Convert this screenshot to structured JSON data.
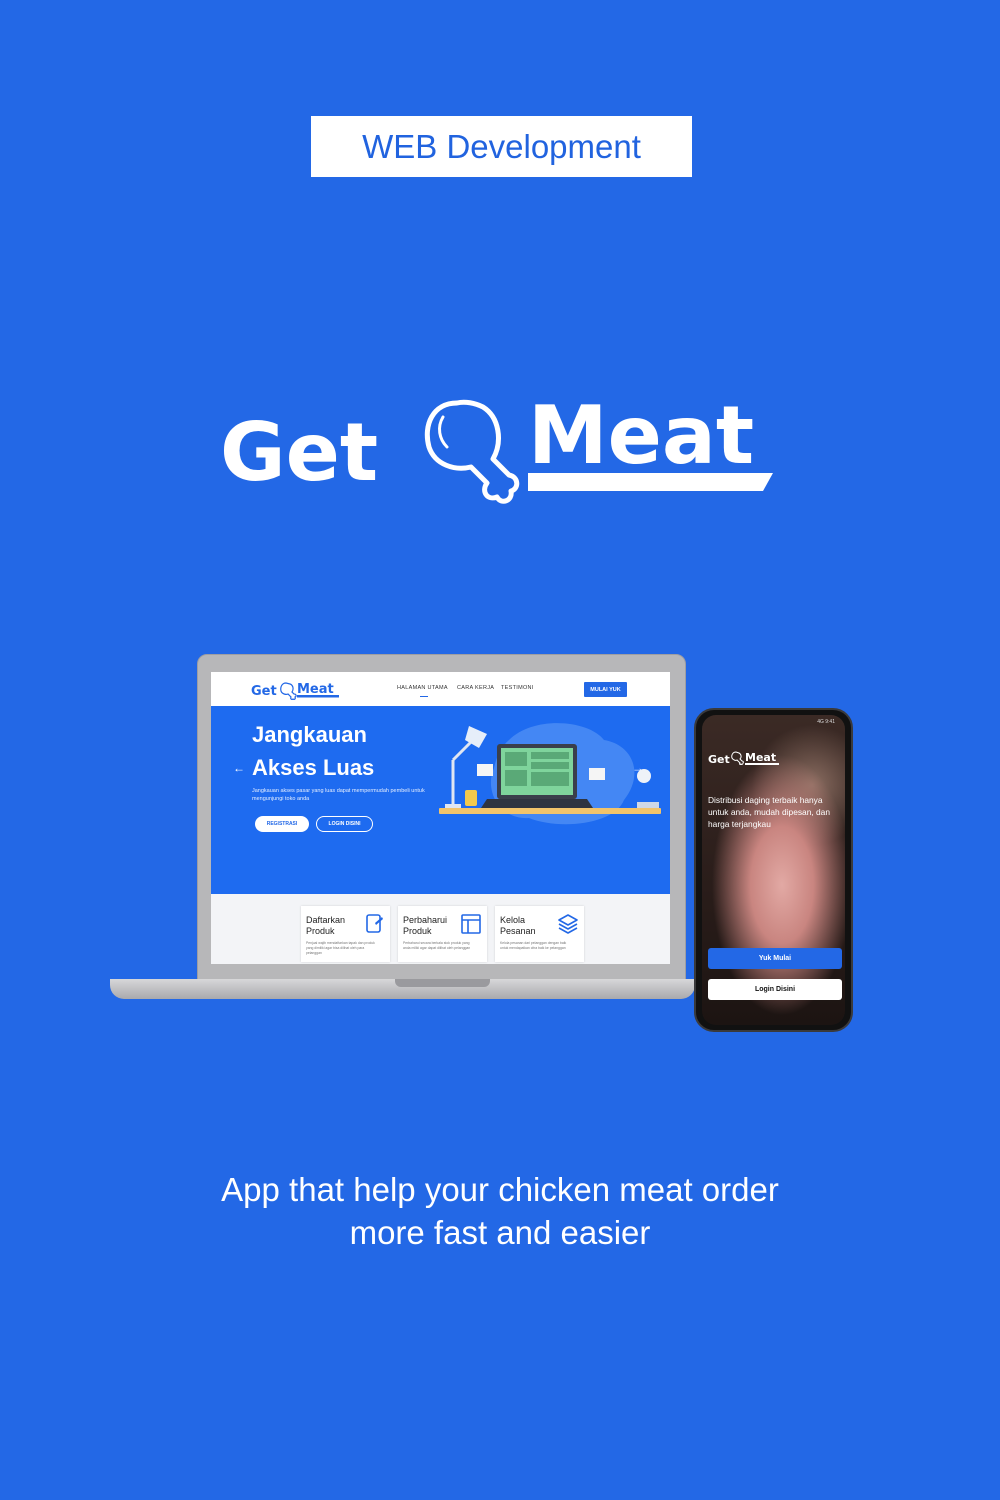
{
  "tag_label": "WEB Development",
  "brand": {
    "name_left": "Get",
    "name_right": "Meat",
    "logo_icon": "drumstick-icon"
  },
  "tagline": {
    "line1": "App that help your chicken meat order",
    "line2": "more fast and easier"
  },
  "colors": {
    "background": "#2368e6",
    "accent": "#1e6bf0",
    "white": "#ffffff"
  },
  "laptop": {
    "nav": {
      "logo_left": "Get",
      "logo_right": "Meat",
      "items": [
        "HALAMAN UTAMA",
        "CARA KERJA",
        "TESTIMONI"
      ],
      "cta": "MULAI YUK"
    },
    "hero": {
      "title_line1": "Jangkauan",
      "title_line2": "Akses Luas",
      "description": "Jangkauan akses pasar yang luas dapat mempermudah pembeli untuk mengunjungi toko anda",
      "btn_register": "REGISTRASI",
      "btn_login": "LOGIN DISINI",
      "arrow_left": "←",
      "arrow_right": "→"
    },
    "features": [
      {
        "title_line1": "Daftarkan",
        "title_line2": "Produk",
        "text": "Penjual wajib mendaftarkan tapak dan produk yang dimiliki agar bisa dilihat oleh para pelanggan",
        "icon": "document-icon"
      },
      {
        "title_line1": "Perbaharui",
        "title_line2": "Produk",
        "text": "Perbaharui secara berkala stok produk yang anda miliki agar dapat dilihat oleh pelanggan",
        "icon": "layout-icon"
      },
      {
        "title_line1": "Kelola",
        "title_line2": "Pesanan",
        "text": "Kelola pesanan dari pelanggan dengan baik untuk mendapatkan citra baik ke pelanggan",
        "icon": "layers-icon"
      }
    ]
  },
  "phone": {
    "status": "4G 9:41",
    "logo_left": "Get",
    "logo_right": "Meat",
    "text": "Distribusi daging terbaik hanya untuk anda, mudah dipesan, dan harga terjangkau",
    "btn_primary": "Yuk Mulai",
    "btn_secondary": "Login Disini"
  }
}
